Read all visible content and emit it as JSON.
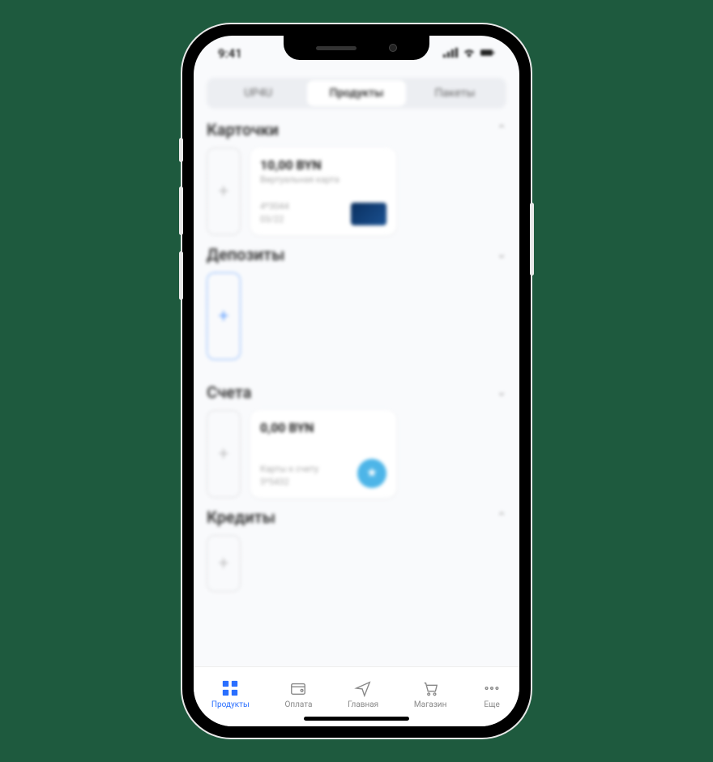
{
  "status": {
    "time": "9:41"
  },
  "tabs": [
    {
      "label": "UP4U",
      "active": false
    },
    {
      "label": "Продукты",
      "active": true
    },
    {
      "label": "Пакеты",
      "active": false
    }
  ],
  "sections": {
    "cards": {
      "title": "Карточки",
      "item": {
        "amount": "10,00 BYN",
        "subtitle": "Виртуальная карта",
        "number": "4*3044",
        "expiry": "03/22"
      }
    },
    "deposits": {
      "title": "Депозиты"
    },
    "accounts": {
      "title": "Счета",
      "item": {
        "amount": "0,00 BYN",
        "subtitle": "Карты к счету",
        "number": "5*5432"
      }
    },
    "credits": {
      "title": "Кредиты"
    }
  },
  "nav": [
    {
      "label": "Продукты",
      "active": true
    },
    {
      "label": "Оплата",
      "active": false
    },
    {
      "label": "Главная",
      "active": false
    },
    {
      "label": "Магазин",
      "active": false
    },
    {
      "label": "Еще",
      "active": false
    }
  ]
}
